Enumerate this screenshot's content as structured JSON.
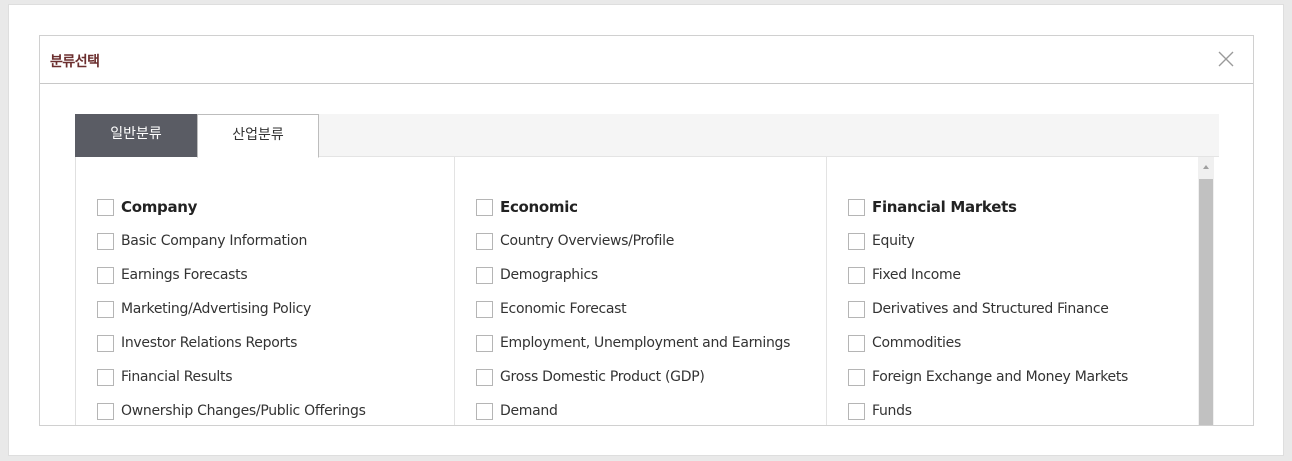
{
  "modal": {
    "title": "분류선택"
  },
  "tabs": [
    {
      "label": "일반분류",
      "active": true
    },
    {
      "label": "산업분류",
      "active": false
    }
  ],
  "columns": [
    {
      "header": "Company",
      "items": [
        "Basic Company Information",
        "Earnings Forecasts",
        "Marketing/Advertising Policy",
        "Investor Relations Reports",
        "Financial Results",
        "Ownership Changes/Public Offerings"
      ]
    },
    {
      "header": "Economic",
      "items": [
        "Country Overviews/Profile",
        "Demographics",
        "Economic Forecast",
        "Employment, Unemployment and Earnings",
        "Gross Domestic Product (GDP)",
        "Demand"
      ]
    },
    {
      "header": "Financial Markets",
      "items": [
        "Equity",
        "Fixed Income",
        "Derivatives and Structured Finance",
        "Commodities",
        "Foreign Exchange and Money Markets",
        "Funds"
      ]
    }
  ],
  "icons": {
    "close": "close-icon",
    "scroll_up": "scroll-up-arrow-icon"
  },
  "colors": {
    "title": "#6b2e2e",
    "tab_active_bg": "#5a5c64"
  }
}
